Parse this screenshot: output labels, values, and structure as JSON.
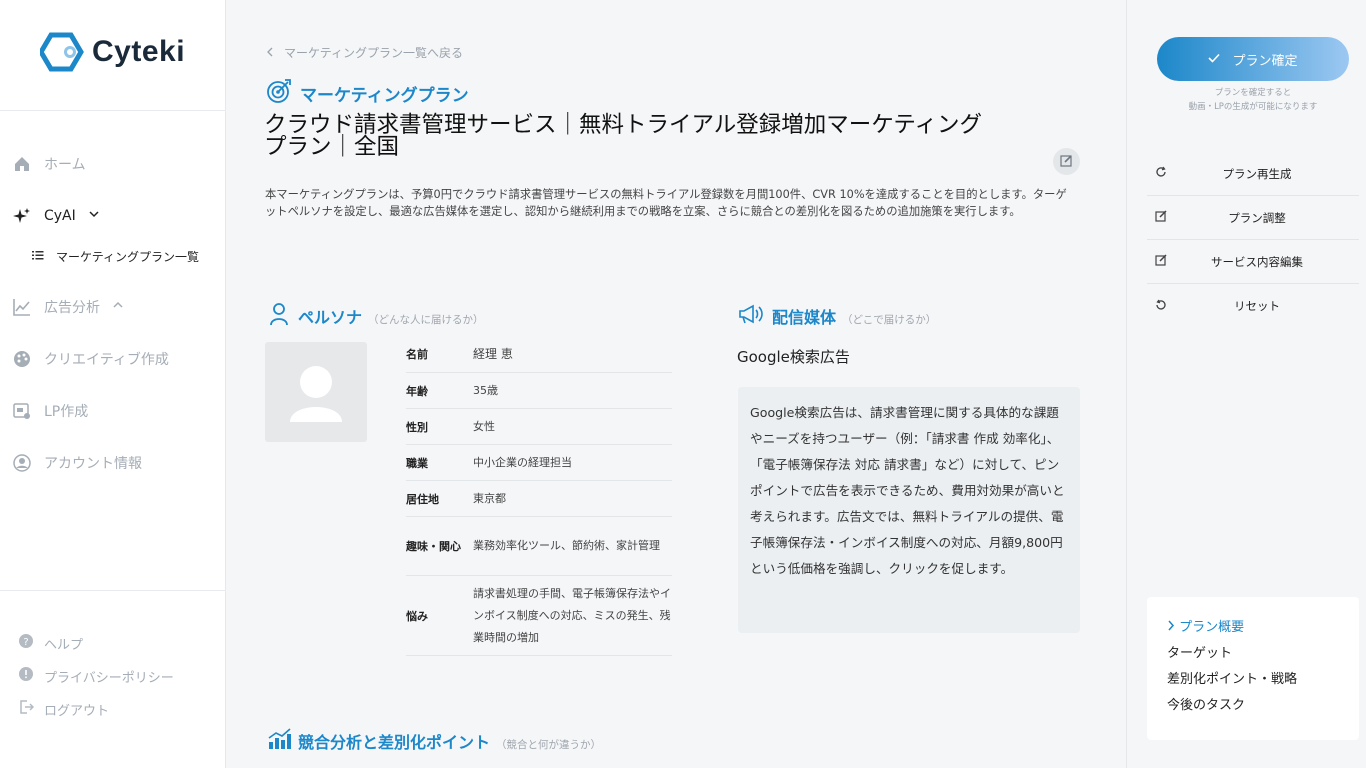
{
  "brand": {
    "name": "Cyteki"
  },
  "sidebar": {
    "home": "ホーム",
    "cyai": "CyAI",
    "marketing_list": "マーケティングプラン一覧",
    "ad_analysis": "広告分析",
    "creative": "クリエイティブ作成",
    "lp": "LP作成",
    "account": "アカウント情報",
    "help": "ヘルプ",
    "privacy": "プライバシーポリシー",
    "logout": "ログアウト"
  },
  "main": {
    "back": "マーケティングプラン一覧へ戻る",
    "tag": "マーケティングプラン",
    "title_line1": "クラウド請求書管理サービス｜無料トライアル登録増加マーケティング",
    "title_line2": "プラン｜全国",
    "description": "本マーケティングプランは、予算0円でクラウド請求書管理サービスの無料トライアル登録数を月間100件、CVR 10%を達成することを目的とします。ターゲットペルソナを設定し、最適な広告媒体を選定し、認知から継続利用までの戦略を立案、さらに競合との差別化を図るための追加施策を実行します。",
    "persona": {
      "title": "ペルソナ",
      "subtitle": "（どんな人に届けるか）",
      "rows": [
        {
          "k": "名前",
          "v": "経理 恵"
        },
        {
          "k": "年齢",
          "v": "35歳"
        },
        {
          "k": "性別",
          "v": "女性"
        },
        {
          "k": "職業",
          "v": "中小企業の経理担当"
        },
        {
          "k": "居住地",
          "v": "東京都"
        },
        {
          "k": "趣味・関心",
          "v": "業務効率化ツール、節約術、家計管理"
        },
        {
          "k": "悩み",
          "v": "請求書処理の手間、電子帳簿保存法やインボイス制度への対応、ミスの発生、残業時間の増加"
        }
      ]
    },
    "media": {
      "title": "配信媒体",
      "subtitle": "（どこで届けるか）",
      "name": "Google検索広告",
      "body": "Google検索広告は、請求書管理に関する具体的な課題やニーズを持つユーザー（例：「請求書 作成 効率化」、「電子帳簿保存法 対応 請求書」など）に対して、ピンポイントで広告を表示できるため、費用対効果が高いと考えられます。広告文では、無料トライアルの提供、電子帳簿保存法・インボイス制度への対応、月額9,800円という低価格を強調し、クリックを促します。"
    },
    "competitor": {
      "title": "競合分析と差別化ポイント",
      "subtitle": "（競合と何が違うか）"
    }
  },
  "right": {
    "confirm": "プラン確定",
    "confirm_note_1": "プランを確定すると",
    "confirm_note_2": "動画・LPの生成が可能になります",
    "actions": [
      "プラン再生成",
      "プラン調整",
      "サービス内容編集",
      "リセット"
    ],
    "toc": [
      "プラン概要",
      "ターゲット",
      "差別化ポイント・戦略",
      "今後のタスク"
    ]
  },
  "colors": {
    "accent": "#1c87c9",
    "muted": "#a5adb6"
  }
}
